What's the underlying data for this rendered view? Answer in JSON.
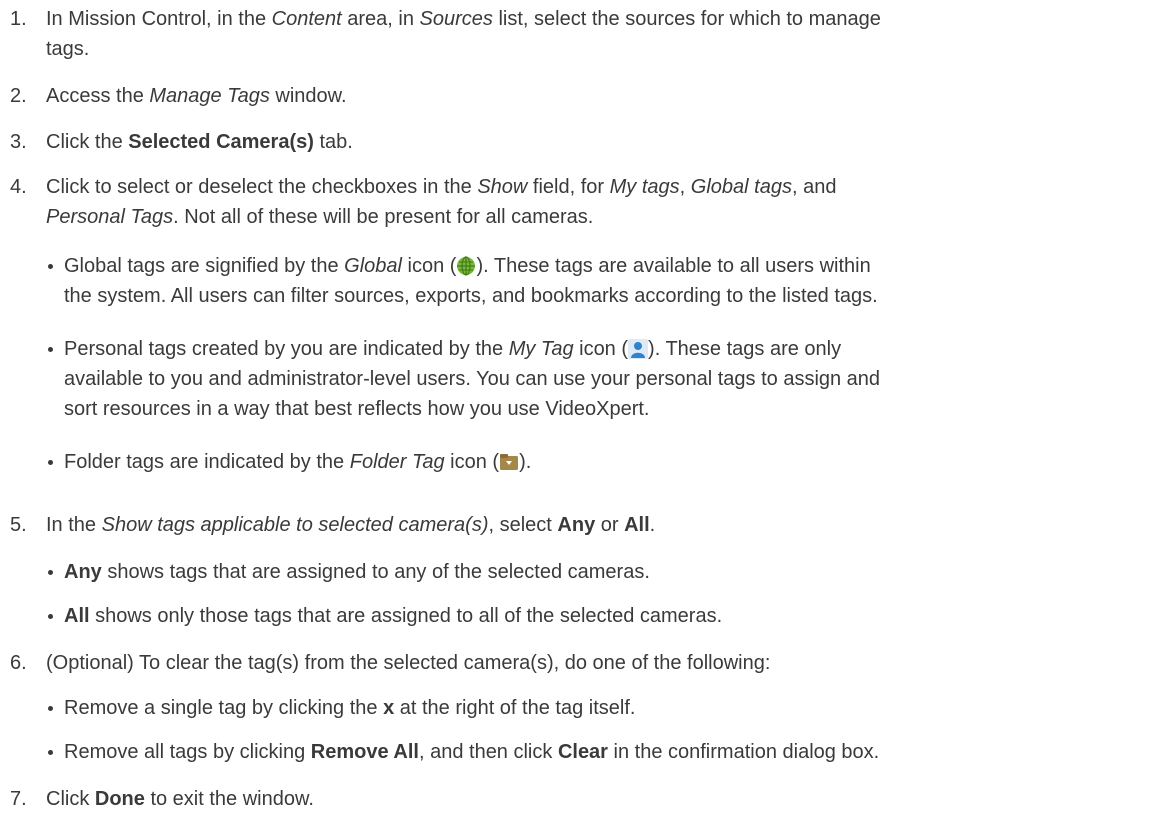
{
  "steps": {
    "s1": {
      "num": "1.",
      "a": "In Mission Control, in the ",
      "b": "Content",
      "c": " area, in ",
      "d": "Sources",
      "e": " list, select the sources for which to manage",
      "f": "tags."
    },
    "s2": {
      "num": "2.",
      "a": "Access the ",
      "b": "Manage Tags",
      "c": " window."
    },
    "s3": {
      "num": "3.",
      "a": "Click the ",
      "b": "Selected Camera(s)",
      "c": " tab."
    },
    "s4": {
      "num": "4.",
      "a": "Click to select or deselect the checkboxes in the ",
      "b": "Show",
      "c": " field, for ",
      "d": "My tags",
      "e": ", ",
      "f": "Global tags",
      "g": ", and",
      "h": "Personal Tags",
      "i": ". Not all of these will be present for all cameras.",
      "bullets": {
        "b1": {
          "a": "Global tags are signified by the ",
          "b": "Global",
          "c": " icon (",
          "d": "). These tags are available to all users within",
          "e": "the system. All users can filter sources, exports, and bookmarks according to the listed tags."
        },
        "b2": {
          "a": "Personal tags created by you are indicated by the ",
          "b": "My Tag",
          "c": " icon (",
          "d": "). These tags are only",
          "e": "available to you and administrator-level users. You can use your personal tags to assign and",
          "f": "sort resources in a way that best reflects how you use VideoXpert."
        },
        "b3": {
          "a": "Folder tags are indicated by the ",
          "b": "Folder Tag",
          "c": " icon (",
          "d": ")."
        }
      }
    },
    "s5": {
      "num": "5.",
      "a": "In the ",
      "b": "Show tags applicable to selected camera(s)",
      "c": ", select ",
      "d": "Any",
      "e": " or ",
      "f": "All",
      "g": ".",
      "bullets": {
        "b1": {
          "a": "Any",
          "b": " shows tags that are assigned to any of the selected cameras."
        },
        "b2": {
          "a": "All",
          "b": " shows only those tags that are assigned to all of the selected cameras."
        }
      }
    },
    "s6": {
      "num": "6.",
      "a": "(Optional) To clear the tag(s) from the selected camera(s), do one of the following:",
      "bullets": {
        "b1": {
          "a": "Remove a single tag by clicking the ",
          "b": "x",
          "c": " at the right of the tag itself."
        },
        "b2": {
          "a": "Remove all tags by clicking ",
          "b": "Remove All",
          "c": ", and then click ",
          "d": "Clear",
          "e": " in the confirmation dialog box."
        }
      }
    },
    "s7": {
      "num": "7.",
      "a": "Click ",
      "b": "Done",
      "c": " to exit the window."
    }
  },
  "icons": {
    "global": "globe-icon",
    "my_tag": "person-icon",
    "folder_tag": "folder-icon"
  },
  "colors": {
    "text": "#3a3a3a",
    "globe": "#7cb83a",
    "person": "#2b84d0",
    "folder": "#a5874a"
  }
}
